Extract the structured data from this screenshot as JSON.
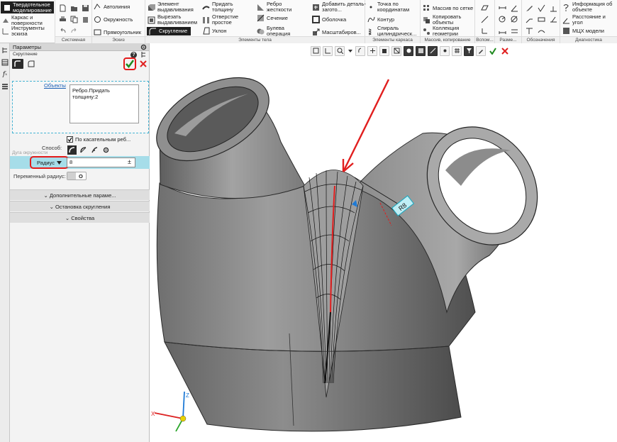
{
  "ribbon": {
    "mode_tabs": [
      "Твердотельное моделирование",
      "Каркас и поверхности",
      "Инструменты эскиза"
    ],
    "sketch_tools": [
      "Автолиния",
      "Окружность",
      "Прямоугольник"
    ],
    "body_tools": [
      "Элемент выдавливания",
      "Вырезать выдавливанием",
      "Скругление",
      "Придать толщину",
      "Отверстие простое",
      "Уклон",
      "Ребро жесткости",
      "Сечение",
      "Булева операция",
      "Добавить деталь-загото...",
      "Оболочка",
      "Масштабиров..."
    ],
    "wire_tools": [
      "Точка по координатам",
      "Контур",
      "Спираль цилиндрическ..."
    ],
    "array_tools": [
      "Массив по сетке",
      "Копировать объекты",
      "Коллекция геометрии"
    ],
    "diag_tools": [
      "Информация об объекте",
      "Расстояние и угол",
      "МЦХ модели"
    ],
    "group_labels": [
      "Системная",
      "Эскиз",
      "Элементы тела",
      "Элементы каркаса",
      "Массив, копирование",
      "Вспом...",
      "Разме...",
      "Обозначения",
      "Диагностика"
    ]
  },
  "panel": {
    "title": "Параметры",
    "operation": "Скругление",
    "objects_link": "Объекты",
    "objects_list": [
      "Ребро.Придать толщину:2"
    ],
    "tangent_checkbox": "По касательным реб...",
    "tangent_checked": true,
    "method_label": "Способ:",
    "arc_label": "Дуга окружности",
    "radius_label": "Радиус",
    "radius_value": "8",
    "radius_suffix": "±",
    "variable_radius_label": "Переменный радиус:",
    "toggle_off": "O",
    "sections": [
      "Дополнительные параме...",
      "Остановка скругления",
      "Свойства"
    ]
  },
  "viewport": {
    "dimension_label": "R8",
    "axis_labels": [
      "X",
      "Y",
      "Z"
    ]
  },
  "colors": {
    "accent": "#1f8a1f",
    "cancel": "#e02020",
    "highlight_row": "#a6dde9",
    "annotation": "#e11e1e",
    "model_gray": "#8a8a8a"
  }
}
